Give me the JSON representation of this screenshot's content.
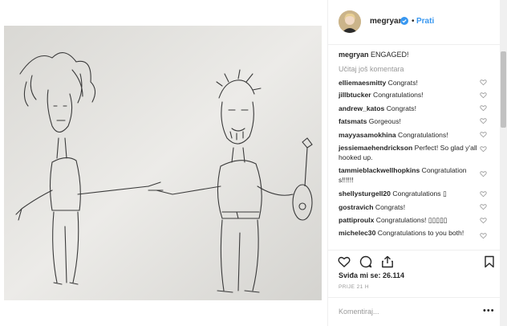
{
  "post": {
    "username": "megryan",
    "follow_label": "Prati",
    "dot": "•",
    "caption_user": "megryan",
    "caption_text": "ENGAGED!",
    "load_more": "Učitaj još komentara"
  },
  "comments": [
    {
      "user": "elliemaesmitty",
      "text": "Congrats!"
    },
    {
      "user": "jillbtucker",
      "text": "Congratulations!"
    },
    {
      "user": "andrew_katos",
      "text": "Congrats!"
    },
    {
      "user": "fatsmats",
      "text": "Gorgeous!"
    },
    {
      "user": "mayyasamokhina",
      "text": "Congratulations!"
    },
    {
      "user": "jessiemaehendrickson",
      "text": "Perfect! So glad y'all hooked up."
    },
    {
      "user": "tammieblackwellhopkins",
      "text": "Congratulations!!!!!!"
    },
    {
      "user": "shellysturgell20",
      "text": "Congratulations ▯"
    },
    {
      "user": "gostravich",
      "text": "Congrats!"
    },
    {
      "user": "pattiproulx",
      "text": "Congratulations! ▯▯▯▯▯"
    },
    {
      "user": "michelec30",
      "text": "Congratulations to you both!"
    }
  ],
  "actions": {
    "likes": "Sviđa mi se: 26.114",
    "time": "PRIJE 21 H"
  },
  "add_comment": {
    "placeholder": "Komentiraj...",
    "more": "•••"
  },
  "icons": {
    "verified": "verified-badge-icon",
    "heart": "heart-icon",
    "comment": "comment-bubble-icon",
    "share": "share-icon",
    "save": "bookmark-icon"
  },
  "colors": {
    "link_blue": "#3897f0",
    "muted": "#999999",
    "text": "#262626"
  }
}
